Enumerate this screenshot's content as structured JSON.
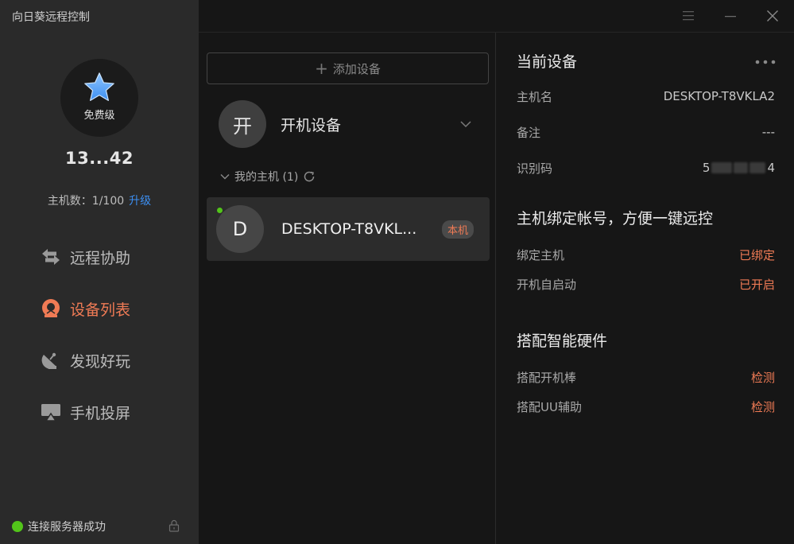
{
  "app": {
    "title": "向日葵远程控制"
  },
  "account": {
    "tier": "免费级",
    "user_id": "13...42",
    "host_count_label": "主机数：1/100",
    "upgrade_label": "升级"
  },
  "nav": {
    "items": [
      {
        "label": "远程协助",
        "icon": "remote-assist-icon",
        "active": false
      },
      {
        "label": "设备列表",
        "icon": "device-list-icon",
        "active": true
      },
      {
        "label": "发现好玩",
        "icon": "discover-icon",
        "active": false
      },
      {
        "label": "手机投屏",
        "icon": "screen-mirror-icon",
        "active": false
      }
    ]
  },
  "status": {
    "text": "连接服务器成功",
    "color": "#52c41a"
  },
  "devices": {
    "add_label": "添加设备",
    "group": {
      "avatar_char": "开",
      "title": "开机设备"
    },
    "subgroup_label": "我的主机 (1)",
    "items": [
      {
        "avatar_char": "D",
        "name": "DESKTOP-T8VKL...",
        "badge": "本机",
        "online": true
      }
    ]
  },
  "details": {
    "current_device": {
      "title": "当前设备",
      "rows": [
        {
          "key": "主机名",
          "value": "DESKTOP-T8VKLA2"
        },
        {
          "key": "备注",
          "value": "---"
        },
        {
          "key": "识别码",
          "value_prefix": "5",
          "value_suffix": "4"
        }
      ]
    },
    "binding": {
      "title": "主机绑定帐号，方便一键远控",
      "rows": [
        {
          "key": "绑定主机",
          "value": "已绑定"
        },
        {
          "key": "开机自启动",
          "value": "已开启"
        }
      ]
    },
    "hardware": {
      "title": "搭配智能硬件",
      "rows": [
        {
          "key": "搭配开机棒",
          "value": "检测"
        },
        {
          "key": "搭配UU辅助",
          "value": "检测"
        }
      ]
    }
  },
  "colors": {
    "accent": "#f07b55",
    "link_blue": "#3c8ef0",
    "online": "#52c41a"
  }
}
